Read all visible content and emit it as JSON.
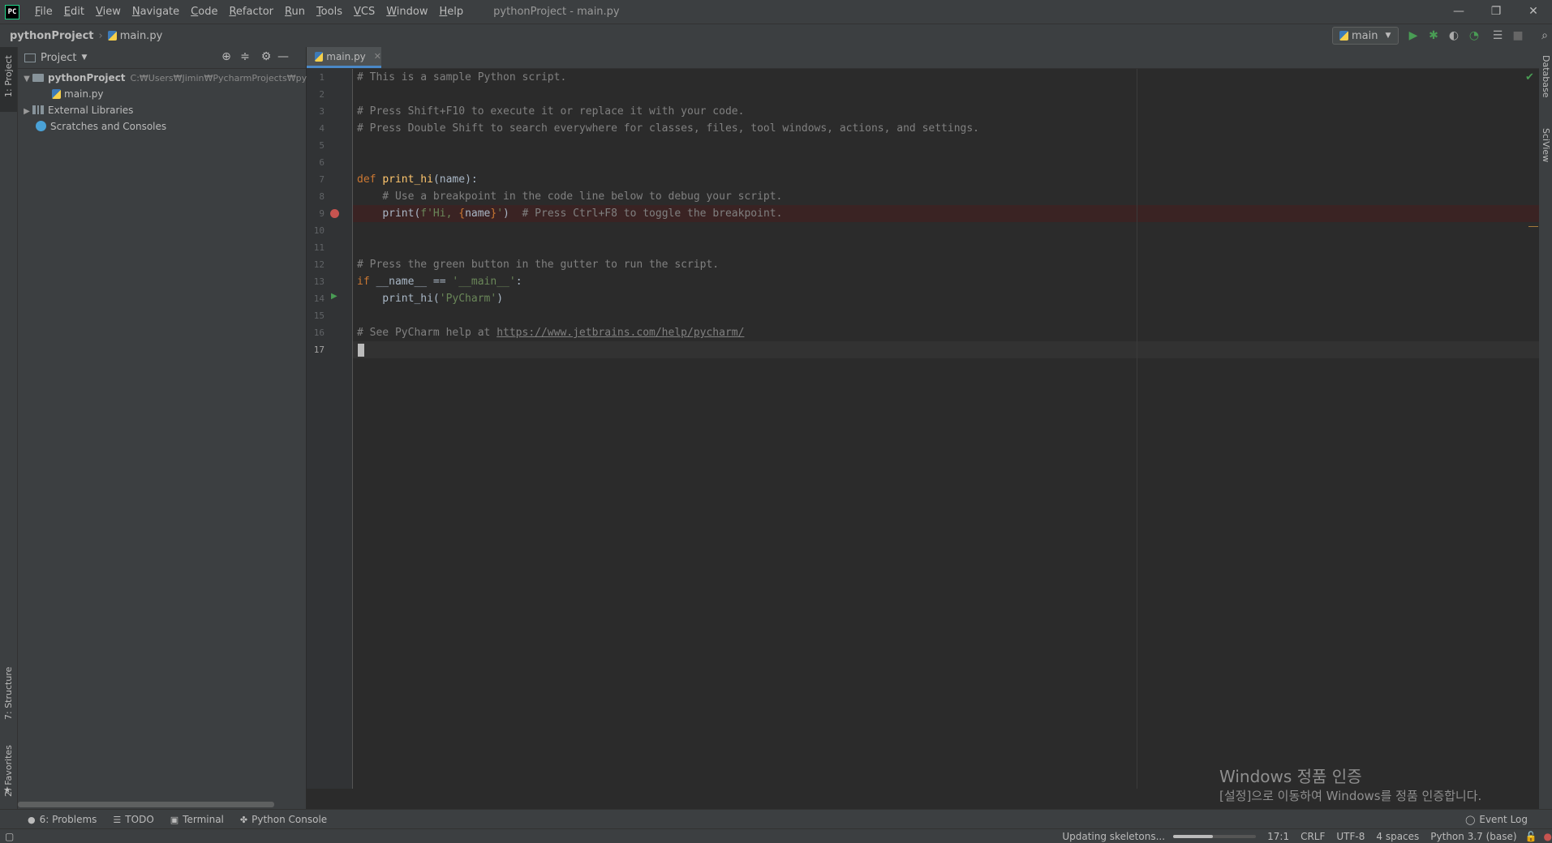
{
  "titlebar": {
    "logo": "PC",
    "menu": [
      "File",
      "Edit",
      "View",
      "Navigate",
      "Code",
      "Refactor",
      "Run",
      "Tools",
      "VCS",
      "Window",
      "Help"
    ],
    "title": "pythonProject - main.py"
  },
  "navbar": {
    "project": "pythonProject",
    "file": "main.py",
    "run_config": "main"
  },
  "left_strip": {
    "project_tab": "1: Project",
    "structure_tab": "7: Structure",
    "favorites_tab": "2: Favorites"
  },
  "right_strip": {
    "database_tab": "Database",
    "sciview_tab": "SciView"
  },
  "project_panel": {
    "title": "Project",
    "tree": {
      "root": "pythonProject",
      "root_path": "C:₩Users₩Jimin₩PycharmProjects₩pythor",
      "file": "main.py",
      "libraries": "External Libraries",
      "scratches": "Scratches and Consoles"
    }
  },
  "editor": {
    "tab": "main.py",
    "line_numbers": [
      "1",
      "2",
      "3",
      "4",
      "5",
      "6",
      "7",
      "8",
      "9",
      "10",
      "11",
      "12",
      "13",
      "14",
      "15",
      "16",
      "17"
    ],
    "code": {
      "l1": "# This is a sample Python script.",
      "l3": "# Press Shift+F10 to execute it or replace it with your code.",
      "l4": "# Press Double Shift to search everywhere for classes, files, tool windows, actions, and settings.",
      "l7_kw": "def ",
      "l7_fn": "print_hi",
      "l7_rest": "(name):",
      "l8": "    # Use a breakpoint in the code line below to debug your script.",
      "l9_indent": "    ",
      "l9_call": "print(",
      "l9_str1": "f'Hi, ",
      "l9_brace_open": "{",
      "l9_var": "name",
      "l9_brace_close": "}",
      "l9_str2": "'",
      "l9_close": ")",
      "l9_comment": "  # Press Ctrl+F8 to toggle the breakpoint.",
      "l12": "# Press the green button in the gutter to run the script.",
      "l13_kw": "if ",
      "l13_rest": "__name__ == ",
      "l13_str": "'__main__'",
      "l13_colon": ":",
      "l14_code": "    print_hi(",
      "l14_str": "'PyCharm'",
      "l14_close": ")",
      "l16_text": "# See PyCharm help at ",
      "l16_url": "https://www.jetbrains.com/help/pycharm/"
    }
  },
  "bottom_tabs": {
    "problems": "6: Problems",
    "todo": "TODO",
    "terminal": "Terminal",
    "python_console": "Python Console",
    "event_log": "Event Log"
  },
  "status": {
    "task": "Updating skeletons...",
    "progress": 0.48,
    "position": "17:1",
    "line_sep": "CRLF",
    "encoding": "UTF-8",
    "indent": "4 spaces",
    "interpreter": "Python 3.7 (base)"
  },
  "watermark": {
    "title": "Windows 정품 인증",
    "subtitle": "[설정]으로 이동하여 Windows를 정품 인증합니다."
  },
  "colors": {
    "background": "#2b2b2b",
    "panel": "#3c3f41",
    "keyword": "#cc7832",
    "function": "#ffc66d",
    "string": "#6a8759",
    "comment": "#808080",
    "breakpoint": "#c75450",
    "run": "#499c54"
  }
}
